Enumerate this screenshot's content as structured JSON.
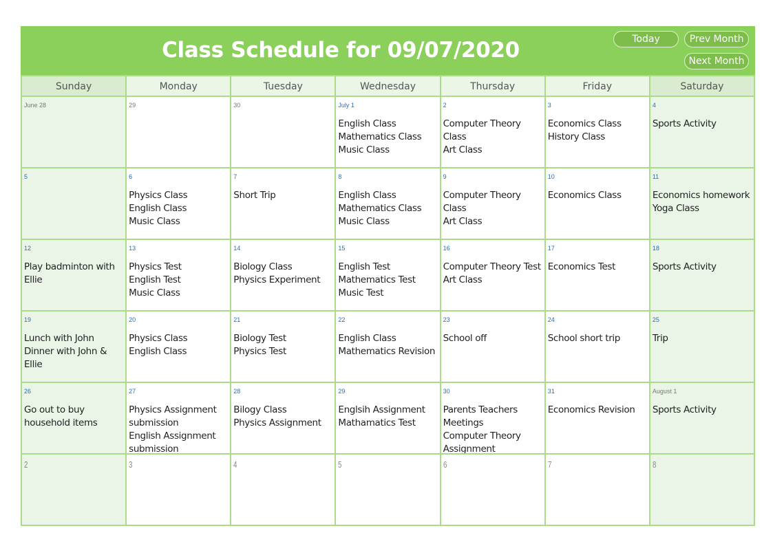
{
  "header": {
    "title": "Class Schedule for 09/07/2020",
    "buttons": {
      "today": "Today",
      "prev": "Prev Month",
      "next": "Next Month"
    }
  },
  "colors": {
    "accent": "#8bd05a",
    "grid_line": "#a9db88",
    "weekend_bg": "#eaf5e7",
    "header_bg": "#ebf6e6"
  },
  "days_of_week": [
    "Sunday",
    "Monday",
    "Tuesday",
    "Wednesday",
    "Thursday",
    "Friday",
    "Saturday"
  ],
  "weeks": [
    [
      {
        "label": "June 28",
        "style": "other",
        "events": []
      },
      {
        "label": "29",
        "style": "other",
        "events": []
      },
      {
        "label": "30",
        "style": "other",
        "events": []
      },
      {
        "label": "July 1",
        "style": "current",
        "events": [
          "English Class",
          "Mathematics Class",
          "Music Class"
        ]
      },
      {
        "label": "2",
        "style": "current",
        "events": [
          "Computer Theory Class",
          "Art Class"
        ]
      },
      {
        "label": "3",
        "style": "current",
        "events": [
          "Economics Class",
          "History Class"
        ]
      },
      {
        "label": "4",
        "style": "current",
        "events": [
          "Sports Activity"
        ]
      }
    ],
    [
      {
        "label": "5",
        "style": "current",
        "events": []
      },
      {
        "label": "6",
        "style": "current",
        "events": [
          "Physics Class",
          "English Class",
          "Music Class"
        ]
      },
      {
        "label": "7",
        "style": "current",
        "events": [
          "Short Trip"
        ]
      },
      {
        "label": "8",
        "style": "current",
        "events": [
          "English Class",
          "Mathematics Class",
          "Music Class"
        ]
      },
      {
        "label": "9",
        "style": "current",
        "events": [
          "Computer Theory Class",
          "Art Class"
        ]
      },
      {
        "label": "10",
        "style": "current",
        "events": [
          "Economics Class"
        ]
      },
      {
        "label": "11",
        "style": "current",
        "events": [
          "Economics homework",
          "Yoga Class"
        ]
      }
    ],
    [
      {
        "label": "12",
        "style": "current",
        "events": [
          "Play badminton with Ellie"
        ]
      },
      {
        "label": "13",
        "style": "current",
        "events": [
          "Physics Test",
          "English Test",
          "Music Class"
        ]
      },
      {
        "label": "14",
        "style": "current",
        "events": [
          "Biology Class",
          "Physics Experiment"
        ]
      },
      {
        "label": "15",
        "style": "current",
        "events": [
          "English Test",
          "Mathematics Test",
          "Music Test"
        ]
      },
      {
        "label": "16",
        "style": "current",
        "events": [
          "Computer Theory Test",
          "Art Class"
        ]
      },
      {
        "label": "17",
        "style": "current",
        "events": [
          "Economics Test"
        ]
      },
      {
        "label": "18",
        "style": "current",
        "events": [
          "Sports Activity"
        ]
      }
    ],
    [
      {
        "label": "19",
        "style": "current",
        "events": [
          "Lunch with John",
          "Dinner with John & Ellie"
        ]
      },
      {
        "label": "20",
        "style": "current",
        "events": [
          "Physics Class",
          "English Class"
        ]
      },
      {
        "label": "21",
        "style": "current",
        "events": [
          "Biology Test",
          "Physics Test"
        ]
      },
      {
        "label": "22",
        "style": "current",
        "events": [
          "English Class",
          "Mathematics Revision"
        ]
      },
      {
        "label": "23",
        "style": "current",
        "events": [
          "School off"
        ]
      },
      {
        "label": "24",
        "style": "current",
        "events": [
          "School short trip"
        ]
      },
      {
        "label": "25",
        "style": "current",
        "events": [
          "Trip"
        ]
      }
    ],
    [
      {
        "label": "26",
        "style": "current",
        "events": [
          "Go out to buy household items"
        ]
      },
      {
        "label": "27",
        "style": "current",
        "events": [
          "Physics Assignment submission",
          "English Assignment submission"
        ]
      },
      {
        "label": "28",
        "style": "current",
        "events": [
          "Bilogy Class",
          "Physics Assignment"
        ]
      },
      {
        "label": "29",
        "style": "current",
        "events": [
          "Englsih Assignment",
          "Mathamatics Test"
        ]
      },
      {
        "label": "30",
        "style": "current",
        "events": [
          "Parents Teachers Meetings",
          "Computer Theory Assignment"
        ]
      },
      {
        "label": "31",
        "style": "current",
        "events": [
          "Economics Revision"
        ]
      },
      {
        "label": "August 1",
        "style": "other",
        "events": [
          "Sports Activity"
        ]
      }
    ],
    [
      {
        "label": "2",
        "style": "big",
        "events": []
      },
      {
        "label": "3",
        "style": "big",
        "events": []
      },
      {
        "label": "4",
        "style": "big",
        "events": []
      },
      {
        "label": "5",
        "style": "big",
        "events": []
      },
      {
        "label": "6",
        "style": "big",
        "events": []
      },
      {
        "label": "7",
        "style": "big",
        "events": []
      },
      {
        "label": "8",
        "style": "big",
        "events": []
      }
    ]
  ]
}
